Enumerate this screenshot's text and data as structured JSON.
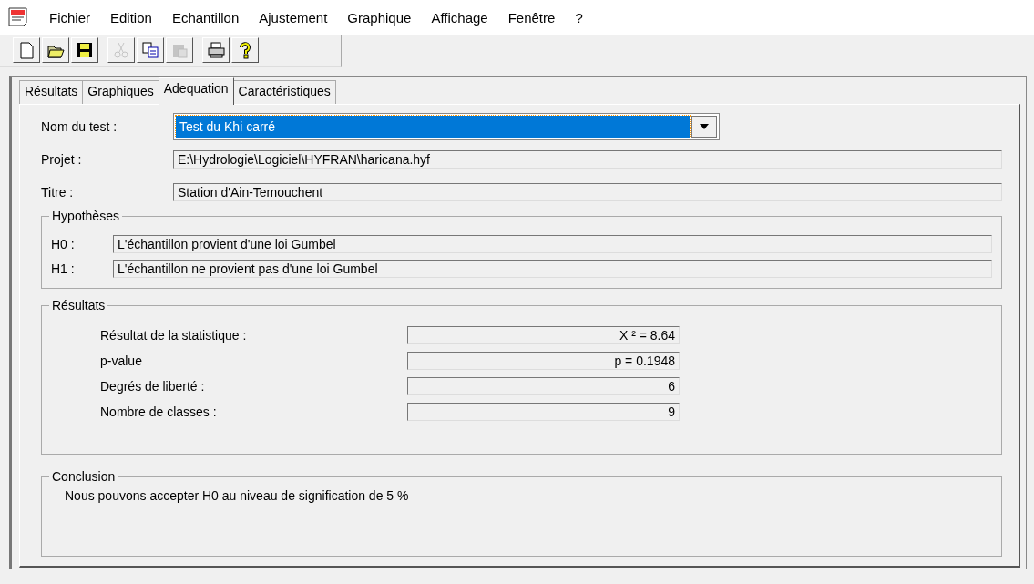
{
  "menu": [
    "Fichier",
    "Edition",
    "Echantillon",
    "Ajustement",
    "Graphique",
    "Affichage",
    "Fenêtre",
    "?"
  ],
  "toolbar": [
    [
      {
        "kind": "new",
        "disabled": false
      },
      {
        "kind": "open",
        "disabled": false
      },
      {
        "kind": "save",
        "disabled": false
      }
    ],
    [
      {
        "kind": "cut",
        "disabled": true
      },
      {
        "kind": "copy",
        "disabled": false
      },
      {
        "kind": "paste",
        "disabled": true
      }
    ],
    [
      {
        "kind": "print",
        "disabled": false
      },
      {
        "kind": "help",
        "disabled": false
      }
    ]
  ],
  "tabs": [
    {
      "label": "Résultats",
      "selected": false
    },
    {
      "label": "Graphiques",
      "selected": false
    },
    {
      "label": "Adequation",
      "selected": true
    },
    {
      "label": "Caractéristiques",
      "selected": false
    }
  ],
  "test": {
    "label": "Nom du test :",
    "value": "Test du Khi carré"
  },
  "fields": [
    {
      "label": "Projet :",
      "value": "E:\\Hydrologie\\Logiciel\\HYFRAN\\haricana.hyf"
    },
    {
      "label": "Titre :",
      "value": "Station d'Ain-Temouchent"
    }
  ],
  "hypotheses": {
    "title": "Hypothèses",
    "rows": [
      {
        "label": "H0 :",
        "value": "L'échantillon provient d'une loi Gumbel"
      },
      {
        "label": "H1 :",
        "value": "L'échantillon ne provient pas d'une loi Gumbel"
      }
    ]
  },
  "results": {
    "title": "Résultats",
    "rows": [
      {
        "label": "Résultat de la statistique :",
        "value": "X ² = 8.64"
      },
      {
        "label": "p-value",
        "value": "p = 0.1948"
      },
      {
        "label": "Degrés de liberté :",
        "value": "6"
      },
      {
        "label": "Nombre de classes :",
        "value": "9"
      }
    ]
  },
  "conclusion": {
    "title": "Conclusion",
    "text": "Nous pouvons accepter H0 au niveau de signification de 5 %"
  }
}
